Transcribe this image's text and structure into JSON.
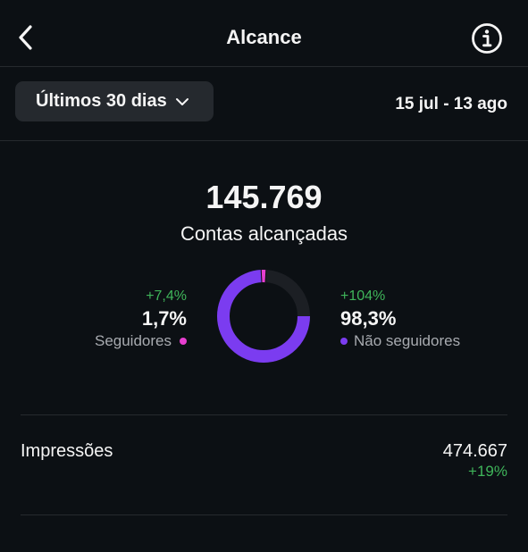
{
  "header": {
    "title": "Alcance",
    "back_icon": "chevron-left-icon",
    "info_icon": "info-circle-icon"
  },
  "filter": {
    "period_label": "Últimos 30 dias",
    "date_range": "15 jul - 13 ago"
  },
  "reach": {
    "total": "145.769",
    "label": "Contas alcançadas",
    "followers": {
      "change": "+7,4%",
      "percent": "1,7%",
      "label": "Seguidores",
      "color": "#e83fd0",
      "value": 1.7
    },
    "non_followers": {
      "change": "+104%",
      "percent": "98,3%",
      "label": "Não seguidores",
      "color": "#7b3cf0",
      "value": 98.3
    }
  },
  "impressions": {
    "label": "Impressões",
    "value": "474.667",
    "change": "+19%"
  },
  "colors": {
    "background": "#0c1014",
    "positive": "#3fb55a",
    "muted_text": "#a8abb0",
    "dropdown_bg": "#25292e"
  }
}
